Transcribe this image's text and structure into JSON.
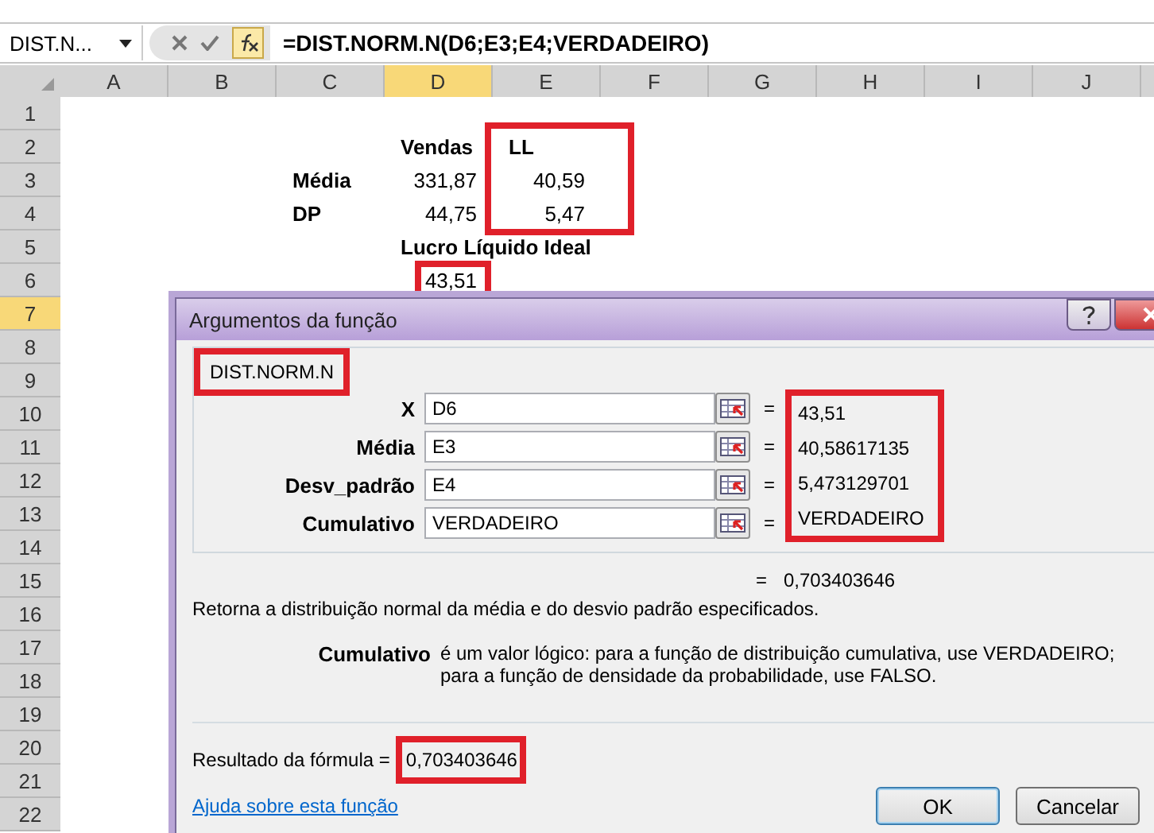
{
  "formula_bar": {
    "name_box": "DIST.N...",
    "formula": "=DIST.NORM.N(D6;E3;E4;VERDADEIRO)"
  },
  "sheet": {
    "columns": [
      {
        "label": "A",
        "selected": false
      },
      {
        "label": "B",
        "selected": false
      },
      {
        "label": "C",
        "selected": false
      },
      {
        "label": "D",
        "selected": true
      },
      {
        "label": "E",
        "selected": false
      },
      {
        "label": "F",
        "selected": false
      },
      {
        "label": "G",
        "selected": false
      },
      {
        "label": "H",
        "selected": false
      },
      {
        "label": "I",
        "selected": false
      },
      {
        "label": "J",
        "selected": false
      }
    ],
    "rows": [
      {
        "number": "1",
        "selected": false
      },
      {
        "number": "2",
        "selected": false,
        "cells": {
          "D": {
            "text": "Vendas",
            "kind": "heading"
          },
          "E": {
            "text": "LL",
            "kind": "heading"
          }
        }
      },
      {
        "number": "3",
        "selected": false,
        "cells": {
          "C": {
            "text": "Média",
            "kind": "heading"
          },
          "D": {
            "text": "331,87",
            "kind": "number"
          },
          "E": {
            "text": "40,59",
            "kind": "number"
          }
        }
      },
      {
        "number": "4",
        "selected": false,
        "cells": {
          "C": {
            "text": "DP",
            "kind": "heading"
          },
          "D": {
            "text": "44,75",
            "kind": "number"
          },
          "E": {
            "text": "5,47",
            "kind": "number"
          }
        }
      },
      {
        "number": "5",
        "selected": false,
        "cells": {
          "D": {
            "text": "Lucro Líquido Ideal",
            "kind": "heading"
          }
        }
      },
      {
        "number": "6",
        "selected": false,
        "cells": {
          "D": {
            "text": "43,51",
            "kind": "number"
          }
        }
      },
      {
        "number": "7",
        "selected": true
      },
      {
        "number": "8",
        "selected": false
      },
      {
        "number": "9",
        "selected": false
      },
      {
        "number": "10",
        "selected": false
      },
      {
        "number": "11",
        "selected": false
      },
      {
        "number": "12",
        "selected": false
      },
      {
        "number": "13",
        "selected": false
      },
      {
        "number": "14",
        "selected": false
      },
      {
        "number": "15",
        "selected": false
      },
      {
        "number": "16",
        "selected": false
      },
      {
        "number": "17",
        "selected": false
      },
      {
        "number": "18",
        "selected": false
      },
      {
        "number": "19",
        "selected": false
      },
      {
        "number": "20",
        "selected": false
      },
      {
        "number": "21",
        "selected": false
      },
      {
        "number": "22",
        "selected": false
      }
    ]
  },
  "dialog": {
    "title": "Argumentos da função",
    "function_name": "DIST.NORM.N",
    "arguments": [
      {
        "label": "X",
        "value": "D6",
        "sign": "=",
        "result": "43,51"
      },
      {
        "label": "Média",
        "value": "E3",
        "sign": "=",
        "result": "40,58617135"
      },
      {
        "label": "Desv_padrão",
        "value": "E4",
        "sign": "=",
        "result": "5,473129701"
      },
      {
        "label": "Cumulativo",
        "value": "VERDADEIRO",
        "sign": "=",
        "result": "VERDADEIRO"
      }
    ],
    "formula_value": {
      "sign": "=",
      "value": "0,703403646"
    },
    "description": "Retorna a distribuição normal da média e do desvio padrão especificados.",
    "argument_help": {
      "name": "Cumulativo",
      "text": "é um valor lógico: para a função de distribuição cumulativa, use VERDADEIRO; para a função de densidade da probabilidade, use FALSO."
    },
    "result_label": "Resultado da fórmula =",
    "result": "0,703403646",
    "help_link": "Ajuda sobre esta função",
    "buttons": [
      {
        "label": "OK",
        "default": true
      },
      {
        "label": "Cancelar",
        "default": false
      }
    ]
  }
}
